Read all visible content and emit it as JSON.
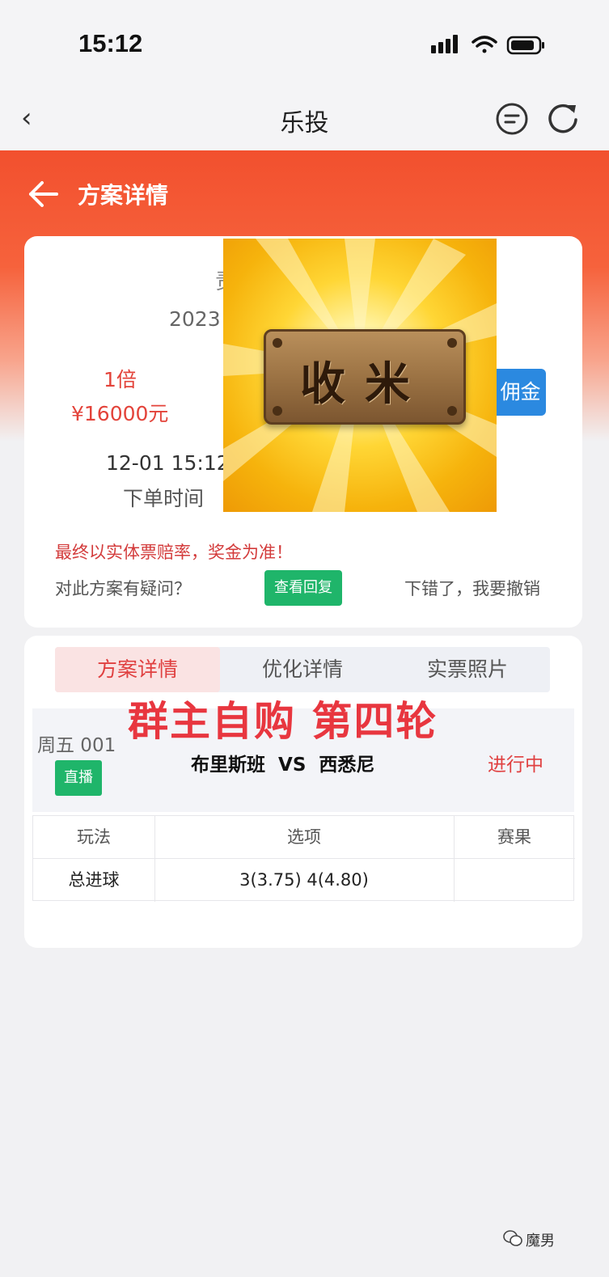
{
  "status_bar": {
    "time": "15:12"
  },
  "nav": {
    "title": "乐投"
  },
  "page": {
    "title": "方案详情"
  },
  "order": {
    "title_partial": "责",
    "date_partial": "2023",
    "multiplier": "1倍",
    "amount": "¥16000元",
    "order_time": "12-01 15:12",
    "order_time_label": "下单时间",
    "commission_label": "佣金"
  },
  "sticker": {
    "text": "收米"
  },
  "notice": "最终以实体票赔率，奖金为准！",
  "question_text": "对此方案有疑问？",
  "reply_button": "查看回复",
  "cancel_link": "下错了，我要撤销",
  "tabs": [
    {
      "label": "方案详情",
      "active": true
    },
    {
      "label": "优化详情",
      "active": false
    },
    {
      "label": "实票照片",
      "active": false
    }
  ],
  "overlay_caption": "群主自购 第四轮",
  "match": {
    "number": "周五 001",
    "live_label": "直播",
    "teams": "布里斯班  VS  西悉尼",
    "status": "进行中"
  },
  "bet_table": {
    "headers": [
      "玩法",
      "选项",
      "赛果"
    ],
    "rows": [
      {
        "play": "总进球",
        "options": "3(3.75) 4(4.80)",
        "result": ""
      }
    ]
  },
  "watermark": "魔男"
}
